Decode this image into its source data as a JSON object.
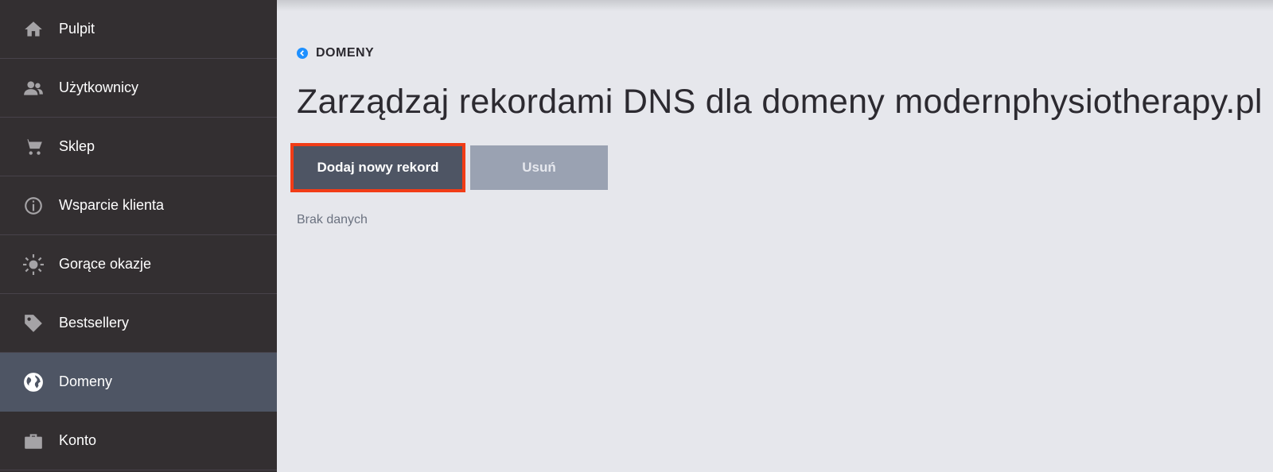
{
  "sidebar": {
    "items": [
      {
        "label": "Pulpit",
        "icon": "home-icon"
      },
      {
        "label": "Użytkownicy",
        "icon": "users-icon"
      },
      {
        "label": "Sklep",
        "icon": "cart-icon"
      },
      {
        "label": "Wsparcie klienta",
        "icon": "info-icon"
      },
      {
        "label": "Gorące okazje",
        "icon": "sun-icon"
      },
      {
        "label": "Bestsellery",
        "icon": "tag-icon"
      },
      {
        "label": "Domeny",
        "icon": "globe-icon",
        "active": true
      },
      {
        "label": "Konto",
        "icon": "briefcase-icon"
      }
    ]
  },
  "main": {
    "breadcrumb": "DOMENY",
    "title": "Zarządzaj rekordami DNS dla domeny modernphysiotherapy.pl",
    "add_button": "Dodaj nowy rekord",
    "delete_button": "Usuń",
    "empty_text": "Brak danych"
  },
  "colors": {
    "sidebar_bg": "#332f31",
    "active_bg": "#4e5564",
    "highlight": "#f13c17",
    "accent": "#1e90ff"
  }
}
